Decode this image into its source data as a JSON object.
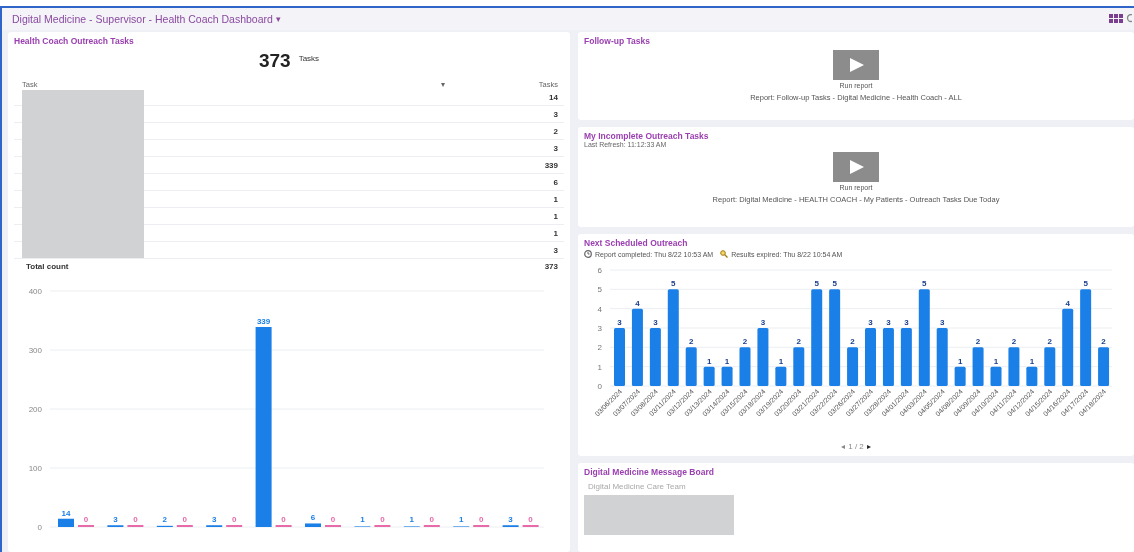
{
  "header": {
    "title": "Digital Medicine - Supervisor - Health Coach Dashboard",
    "caret": "▾"
  },
  "outreach_tasks": {
    "title": "Health Coach Outreach Tasks",
    "total": "373",
    "total_label": "Tasks",
    "columns": [
      "Task",
      "Tasks"
    ],
    "sort_icon": "▾",
    "rows": [
      {
        "value": "14"
      },
      {
        "value": "3"
      },
      {
        "value": "2"
      },
      {
        "value": "3"
      },
      {
        "value": "339"
      },
      {
        "value": "6"
      },
      {
        "value": "1"
      },
      {
        "value": "1"
      },
      {
        "value": "1"
      },
      {
        "value": "3"
      }
    ],
    "footer": {
      "label": "Total count",
      "value": "373"
    },
    "chart_data": {
      "type": "bar",
      "categories": [
        null,
        null,
        null,
        null,
        null,
        null,
        null,
        null,
        null,
        null
      ],
      "yticks": [
        0,
        100,
        200,
        300,
        400
      ],
      "ylim": [
        0,
        400
      ],
      "grid": true,
      "data_labels": true,
      "series": [
        {
          "color": "#1a7fe6",
          "values": [
            14,
            3,
            2,
            3,
            339,
            6,
            1,
            1,
            1,
            3
          ]
        },
        {
          "color": "#e86aa8",
          "values": [
            0,
            0,
            0,
            0,
            0,
            0,
            0,
            0,
            0,
            0
          ]
        }
      ]
    }
  },
  "follow_up": {
    "title": "Follow-up Tasks",
    "button": "Run report",
    "report": "Report: Follow-up Tasks - Digital Medicine - Health Coach - ALL"
  },
  "incomplete": {
    "title": "My Incomplete Outreach Tasks",
    "refresh": "Last Refresh: 11:12:33 AM",
    "button": "Run report",
    "report": "Report: Digital Medicine - HEALTH COACH - My Patients - Outreach Tasks Due Today"
  },
  "next_outreach": {
    "title": "Next Scheduled Outreach",
    "completed": "Report completed: Thu 8/22 10:53 AM",
    "expires": "Results expired: Thu 8/22 10:54 AM",
    "pager_prev": "◂",
    "pager": "1 / 2",
    "pager_next": "▸",
    "chart_data": {
      "type": "bar",
      "yticks": [
        0,
        1,
        2,
        3,
        4,
        5,
        6
      ],
      "ylim": [
        0,
        6
      ],
      "grid": true,
      "data_labels": true,
      "categories": [
        "03/06/2024",
        "03/07/2024",
        "03/08/2024",
        "03/11/2024",
        "03/12/2024",
        "03/13/2024",
        "03/14/2024",
        "03/15/2024",
        "03/18/2024",
        "03/19/2024",
        "03/20/2024",
        "03/21/2024",
        "03/22/2024",
        "03/26/2024",
        "03/27/2024",
        "03/28/2024",
        "04/01/2024",
        "04/03/2024",
        "04/05/2024",
        "04/08/2024",
        "04/09/2024",
        "04/10/2024",
        "04/11/2024",
        "04/12/2024",
        "04/15/2024",
        "04/16/2024",
        "04/17/2024",
        "04/18/2024"
      ],
      "series": [
        {
          "color": "#1a7fe6",
          "values": [
            3,
            4,
            3,
            5,
            2,
            1,
            1,
            2,
            3,
            1,
            2,
            5,
            5,
            2,
            3,
            3,
            3,
            5,
            3,
            1,
            2,
            1,
            2,
            1,
            2,
            4,
            5,
            2
          ]
        }
      ]
    }
  },
  "message_board": {
    "title": "Digital Medicine Message Board",
    "team": "Digital Medicine Care Team"
  }
}
